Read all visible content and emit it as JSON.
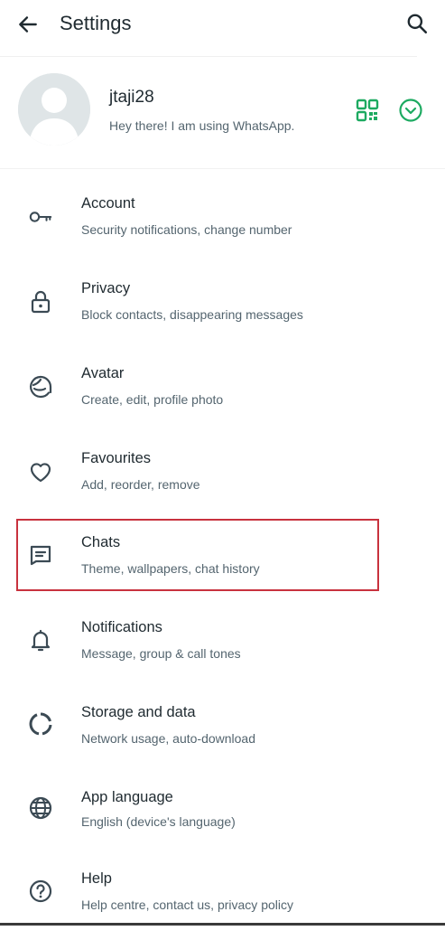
{
  "header": {
    "title": "Settings",
    "back_icon": "arrow-left-icon",
    "search_icon": "search-icon"
  },
  "profile": {
    "name": "jtaji28",
    "status": "Hey there! I am using WhatsApp.",
    "qr_icon": "qr-code-icon",
    "expand_icon": "chevron-down-circle-icon",
    "accent_color": "#1daa61"
  },
  "settings": [
    {
      "title": "Account",
      "subtitle": "Security notifications, change number",
      "icon": "key-icon"
    },
    {
      "title": "Privacy",
      "subtitle": "Block contacts, disappearing messages",
      "icon": "lock-icon"
    },
    {
      "title": "Avatar",
      "subtitle": "Create, edit, profile photo",
      "icon": "avatar-icon"
    },
    {
      "title": "Favourites",
      "subtitle": "Add, reorder, remove",
      "icon": "heart-icon"
    },
    {
      "title": "Chats",
      "subtitle": "Theme, wallpapers, chat history",
      "icon": "chat-icon",
      "highlighted": true
    },
    {
      "title": "Notifications",
      "subtitle": "Message, group & call tones",
      "icon": "bell-icon"
    },
    {
      "title": "Storage and data",
      "subtitle": "Network usage, auto-download",
      "icon": "storage-icon"
    },
    {
      "title": "App language",
      "subtitle": "English (device's language)",
      "icon": "globe-icon"
    },
    {
      "title": "Help",
      "subtitle": "Help centre, contact us, privacy policy",
      "icon": "help-icon"
    }
  ],
  "highlight_color": "#c8323e"
}
